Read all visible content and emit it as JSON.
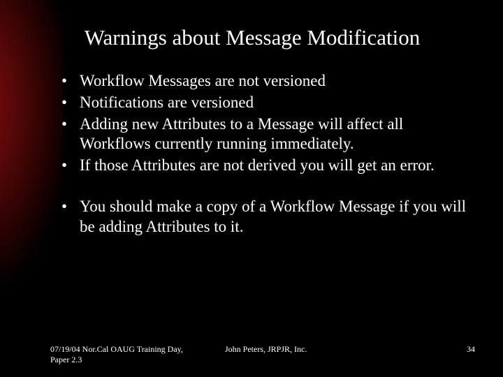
{
  "title": "Warnings about Message Modification",
  "bullets_a": [
    "Workflow Messages are not versioned",
    "Notifications are versioned",
    "Adding new Attributes to a Message will affect all Workflows currently running immediately.",
    "If those Attributes are not derived you will get an error."
  ],
  "bullets_b": [
    "You should make a copy of a Workflow Message if you will be adding Attributes to it."
  ],
  "footer": {
    "left": "07/19/04 Nor.Cal OAUG Training Day, Paper 2.3",
    "center": "John Peters, JRPJR, Inc.",
    "right": "34"
  }
}
